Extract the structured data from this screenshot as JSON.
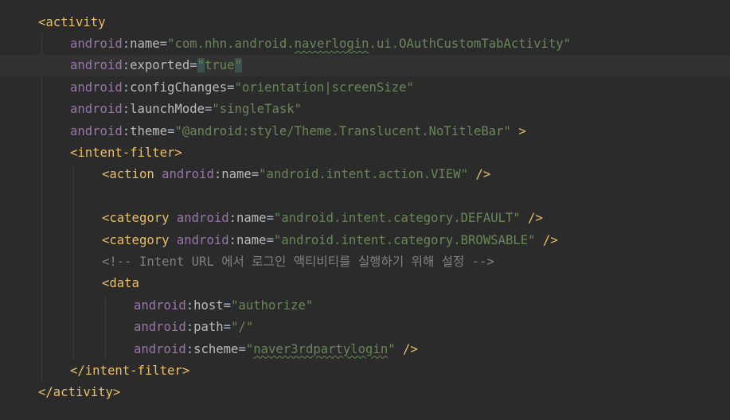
{
  "editor": {
    "lines": [
      {
        "indent": 0,
        "tokens": [
          {
            "t": "tag",
            "v": "<activity"
          }
        ]
      },
      {
        "indent": 1,
        "tokens": [
          {
            "t": "attr-ns",
            "v": "android"
          },
          {
            "t": "punct",
            "v": ":"
          },
          {
            "t": "attr",
            "v": "name"
          },
          {
            "t": "punct",
            "v": "="
          },
          {
            "t": "val",
            "v": "\"com.nhn.android."
          },
          {
            "t": "val sq",
            "v": "naverlogin"
          },
          {
            "t": "val",
            "v": ".ui.OAuthCustomTabActivity\""
          }
        ]
      },
      {
        "indent": 1,
        "current": true,
        "tokens": [
          {
            "t": "attr-ns",
            "v": "android"
          },
          {
            "t": "punct",
            "v": ":"
          },
          {
            "t": "attr",
            "v": "exported"
          },
          {
            "t": "punct",
            "v": "="
          },
          {
            "t": "val cq",
            "v": "\""
          },
          {
            "t": "val",
            "v": "true"
          },
          {
            "t": "val cq",
            "v": "\""
          }
        ]
      },
      {
        "indent": 1,
        "tokens": [
          {
            "t": "attr-ns",
            "v": "android"
          },
          {
            "t": "punct",
            "v": ":"
          },
          {
            "t": "attr",
            "v": "configChanges"
          },
          {
            "t": "punct",
            "v": "="
          },
          {
            "t": "val",
            "v": "\"orientation|screenSize\""
          }
        ]
      },
      {
        "indent": 1,
        "tokens": [
          {
            "t": "attr-ns",
            "v": "android"
          },
          {
            "t": "punct",
            "v": ":"
          },
          {
            "t": "attr",
            "v": "launchMode"
          },
          {
            "t": "punct",
            "v": "="
          },
          {
            "t": "val",
            "v": "\"singleTask\""
          }
        ]
      },
      {
        "indent": 1,
        "tokens": [
          {
            "t": "attr-ns",
            "v": "android"
          },
          {
            "t": "punct",
            "v": ":"
          },
          {
            "t": "attr",
            "v": "theme"
          },
          {
            "t": "punct",
            "v": "="
          },
          {
            "t": "val",
            "v": "\"@android:style/Theme.Translucent.NoTitleBar\""
          },
          {
            "t": "punct",
            "v": " "
          },
          {
            "t": "tag",
            "v": ">"
          }
        ]
      },
      {
        "indent": 1,
        "tokens": [
          {
            "t": "tag",
            "v": "<intent-filter>"
          }
        ]
      },
      {
        "indent": 2,
        "tokens": [
          {
            "t": "tag",
            "v": "<action"
          },
          {
            "t": "punct",
            "v": " "
          },
          {
            "t": "attr-ns",
            "v": "android"
          },
          {
            "t": "punct",
            "v": ":"
          },
          {
            "t": "attr",
            "v": "name"
          },
          {
            "t": "punct",
            "v": "="
          },
          {
            "t": "val",
            "v": "\"android.intent.action.VIEW\""
          },
          {
            "t": "punct",
            "v": " "
          },
          {
            "t": "tag",
            "v": "/>"
          }
        ]
      },
      {
        "indent": 0,
        "tokens": []
      },
      {
        "indent": 2,
        "tokens": [
          {
            "t": "tag",
            "v": "<category"
          },
          {
            "t": "punct",
            "v": " "
          },
          {
            "t": "attr-ns",
            "v": "android"
          },
          {
            "t": "punct",
            "v": ":"
          },
          {
            "t": "attr",
            "v": "name"
          },
          {
            "t": "punct",
            "v": "="
          },
          {
            "t": "val",
            "v": "\"android.intent.category.DEFAULT\""
          },
          {
            "t": "punct",
            "v": " "
          },
          {
            "t": "tag",
            "v": "/>"
          }
        ]
      },
      {
        "indent": 2,
        "tokens": [
          {
            "t": "tag",
            "v": "<category"
          },
          {
            "t": "punct",
            "v": " "
          },
          {
            "t": "attr-ns",
            "v": "android"
          },
          {
            "t": "punct",
            "v": ":"
          },
          {
            "t": "attr",
            "v": "name"
          },
          {
            "t": "punct",
            "v": "="
          },
          {
            "t": "val",
            "v": "\"android.intent.category.BROWSABLE\""
          },
          {
            "t": "punct",
            "v": " "
          },
          {
            "t": "tag",
            "v": "/>"
          }
        ]
      },
      {
        "indent": 2,
        "tokens": [
          {
            "t": "comment",
            "v": "<!-- Intent URL 에서 로그인 액티비티를 실행하기 위해 설정 -->"
          }
        ]
      },
      {
        "indent": 2,
        "tokens": [
          {
            "t": "tag",
            "v": "<data"
          }
        ]
      },
      {
        "indent": 3,
        "tokens": [
          {
            "t": "attr-ns",
            "v": "android"
          },
          {
            "t": "punct",
            "v": ":"
          },
          {
            "t": "attr",
            "v": "host"
          },
          {
            "t": "punct",
            "v": "="
          },
          {
            "t": "val",
            "v": "\"authorize\""
          }
        ]
      },
      {
        "indent": 3,
        "tokens": [
          {
            "t": "attr-ns",
            "v": "android"
          },
          {
            "t": "punct",
            "v": ":"
          },
          {
            "t": "attr",
            "v": "path"
          },
          {
            "t": "punct",
            "v": "="
          },
          {
            "t": "val",
            "v": "\"/\""
          }
        ]
      },
      {
        "indent": 3,
        "tokens": [
          {
            "t": "attr-ns",
            "v": "android"
          },
          {
            "t": "punct",
            "v": ":"
          },
          {
            "t": "attr",
            "v": "scheme"
          },
          {
            "t": "punct",
            "v": "="
          },
          {
            "t": "val",
            "v": "\""
          },
          {
            "t": "val sq",
            "v": "naver3rdpartylogin"
          },
          {
            "t": "val",
            "v": "\""
          },
          {
            "t": "punct",
            "v": " "
          },
          {
            "t": "tag",
            "v": "/>"
          }
        ]
      },
      {
        "indent": 1,
        "tokens": [
          {
            "t": "tag",
            "v": "</intent-filter>"
          }
        ]
      },
      {
        "indent": 0,
        "tokens": [
          {
            "t": "tag",
            "v": "</activity>"
          }
        ]
      }
    ]
  }
}
